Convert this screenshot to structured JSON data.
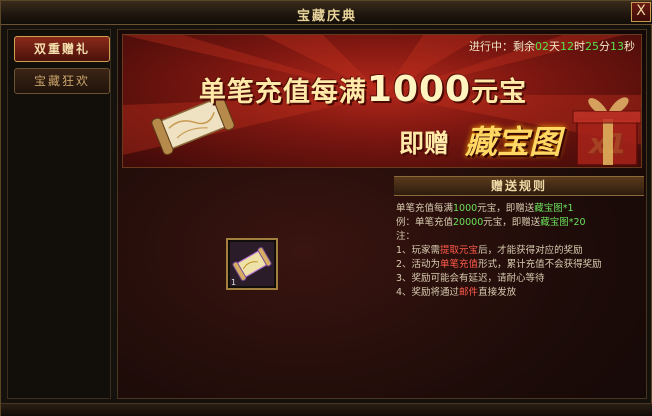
{
  "window": {
    "title": "宝藏庆典",
    "close_label": "X"
  },
  "sidebar": {
    "tabs": [
      {
        "label": "双重赠礼",
        "active": true
      },
      {
        "label": "宝藏狂欢",
        "active": false
      }
    ]
  },
  "banner": {
    "countdown": {
      "prefix": "进行中：剩余",
      "days": "02",
      "days_unit": "天",
      "hours": "12",
      "hours_unit": "时",
      "minutes": "25",
      "minutes_unit": "分",
      "seconds": "13",
      "seconds_unit": "秒"
    },
    "line1_pre": "单笔充值每满",
    "line1_amount": "1000",
    "line1_post": "元宝",
    "line2_pre": "即赠",
    "line2_item": "藏宝图",
    "line2_count": "x1"
  },
  "rules": {
    "header": "赠送规则",
    "lines": [
      {
        "a": "单笔充值每满",
        "b": "1000",
        "c": "元宝，即赠送",
        "d": "藏宝图*1"
      },
      {
        "a": "例：单笔充值",
        "b": "20000",
        "c": "元宝，即赠送",
        "d": "藏宝图*20"
      }
    ],
    "note_label": "注：",
    "notes": [
      {
        "a": "1、玩家需",
        "b": "提取元宝",
        "c": "后，才能获得对应的奖励"
      },
      {
        "a": "2、活动为",
        "b": "单笔充值",
        "c": "形式，累计充值不会获得奖励"
      },
      {
        "a": "3、奖励可能会有延迟，请耐心等待",
        "b": "",
        "c": ""
      },
      {
        "a": "4、奖励将通过",
        "b": "邮件",
        "c": "直接发放"
      }
    ]
  },
  "item": {
    "name": "藏宝图",
    "qty": "1",
    "border_color": "#a0803c"
  },
  "colors": {
    "highlight_green": "#6ae05a",
    "highlight_red": "#ff5a4a",
    "accent_gold": "#e8d49a"
  }
}
